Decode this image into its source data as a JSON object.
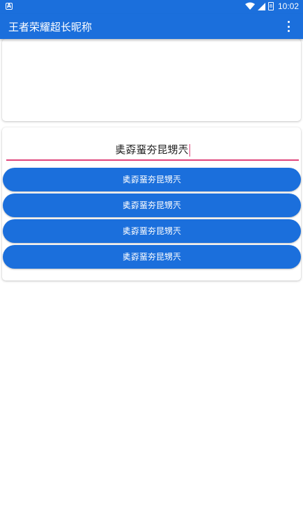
{
  "status_bar": {
    "time": "10:02",
    "battery_label": "8",
    "left_icon": "A"
  },
  "app_bar": {
    "title": "王者荣耀超长昵称"
  },
  "input": {
    "value": "奊孬蝁夯昆甥兲"
  },
  "results": [
    "奊孬蝁夯昆甥兲⁠⁠⁠⁠⁠⁠⁠⁠⁠⁠⁠⁠⁠⁠⁠⁠⁠⁠",
    "⁠⁠⁠⁠⁠⁠⁠⁠⁠⁠⁠⁠⁠⁠⁠⁠⁠⁠奊孬蝁夯昆甥兲",
    "⁠⁠⁠⁠⁠⁠⁠⁠⁠奊孬蝁夯昆甥兲⁠⁠⁠⁠⁠⁠⁠⁠⁠",
    "⁠奊⁠孬⁠蝁⁠夯⁠昆⁠甥⁠兲"
  ],
  "colors": {
    "primary": "#1b6fdc",
    "accent": "#e0467c"
  }
}
